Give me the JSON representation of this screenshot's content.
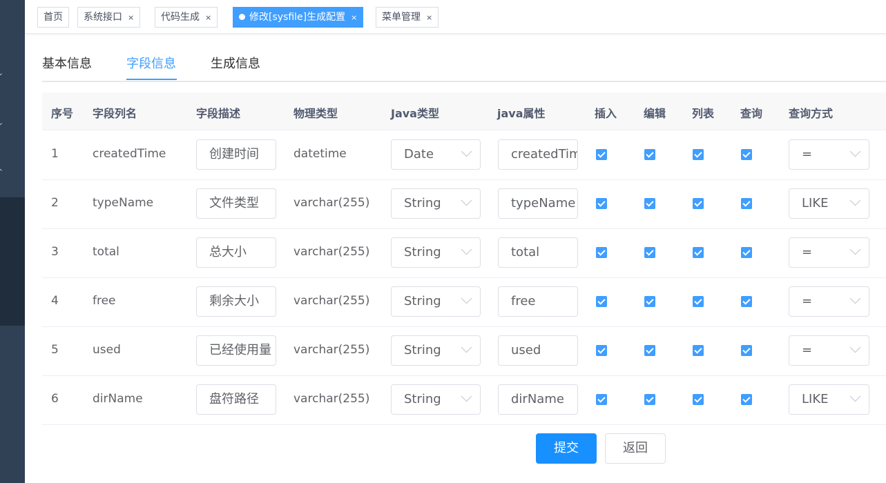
{
  "tags": [
    {
      "label": "首页",
      "closable": false
    },
    {
      "label": "系统接口",
      "closable": true
    },
    {
      "label": "代码生成",
      "closable": true
    },
    {
      "label": "修改[sysfile]生成配置",
      "closable": true,
      "active": true
    },
    {
      "label": "菜单管理",
      "closable": true
    }
  ],
  "tag_close": "×",
  "subtabs": [
    "基本信息",
    "字段信息",
    "生成信息"
  ],
  "active_subtab": 1,
  "columns": [
    "序号",
    "字段列名",
    "字段描述",
    "物理类型",
    "Java类型",
    "java属性",
    "插入",
    "编辑",
    "列表",
    "查询",
    "查询方式"
  ],
  "rows": [
    {
      "index": "1",
      "column": "createdTime",
      "desc": "创建时间",
      "type": "datetime",
      "java_type": "Date",
      "java_field": "createdTime",
      "insert": true,
      "edit": true,
      "list": true,
      "query": true,
      "query_type": "="
    },
    {
      "index": "2",
      "column": "typeName",
      "desc": "文件类型",
      "type": "varchar(255)",
      "java_type": "String",
      "java_field": "typeName",
      "insert": true,
      "edit": true,
      "list": true,
      "query": true,
      "query_type": "LIKE"
    },
    {
      "index": "3",
      "column": "total",
      "desc": "总大小",
      "type": "varchar(255)",
      "java_type": "String",
      "java_field": "total",
      "insert": true,
      "edit": true,
      "list": true,
      "query": true,
      "query_type": "="
    },
    {
      "index": "4",
      "column": "free",
      "desc": "剩余大小",
      "type": "varchar(255)",
      "java_type": "String",
      "java_field": "free",
      "insert": true,
      "edit": true,
      "list": true,
      "query": true,
      "query_type": "="
    },
    {
      "index": "5",
      "column": "used",
      "desc": "已经使用量",
      "type": "varchar(255)",
      "java_type": "String",
      "java_field": "used",
      "insert": true,
      "edit": true,
      "list": true,
      "query": true,
      "query_type": "="
    },
    {
      "index": "6",
      "column": "dirName",
      "desc": "盘符路径",
      "type": "varchar(255)",
      "java_type": "String",
      "java_field": "dirName",
      "insert": true,
      "edit": true,
      "list": true,
      "query": true,
      "query_type": "LIKE"
    }
  ],
  "buttons": {
    "submit": "提交",
    "back": "返回"
  },
  "colors": {
    "primary": "#409eff",
    "sidebar": "#304156"
  }
}
